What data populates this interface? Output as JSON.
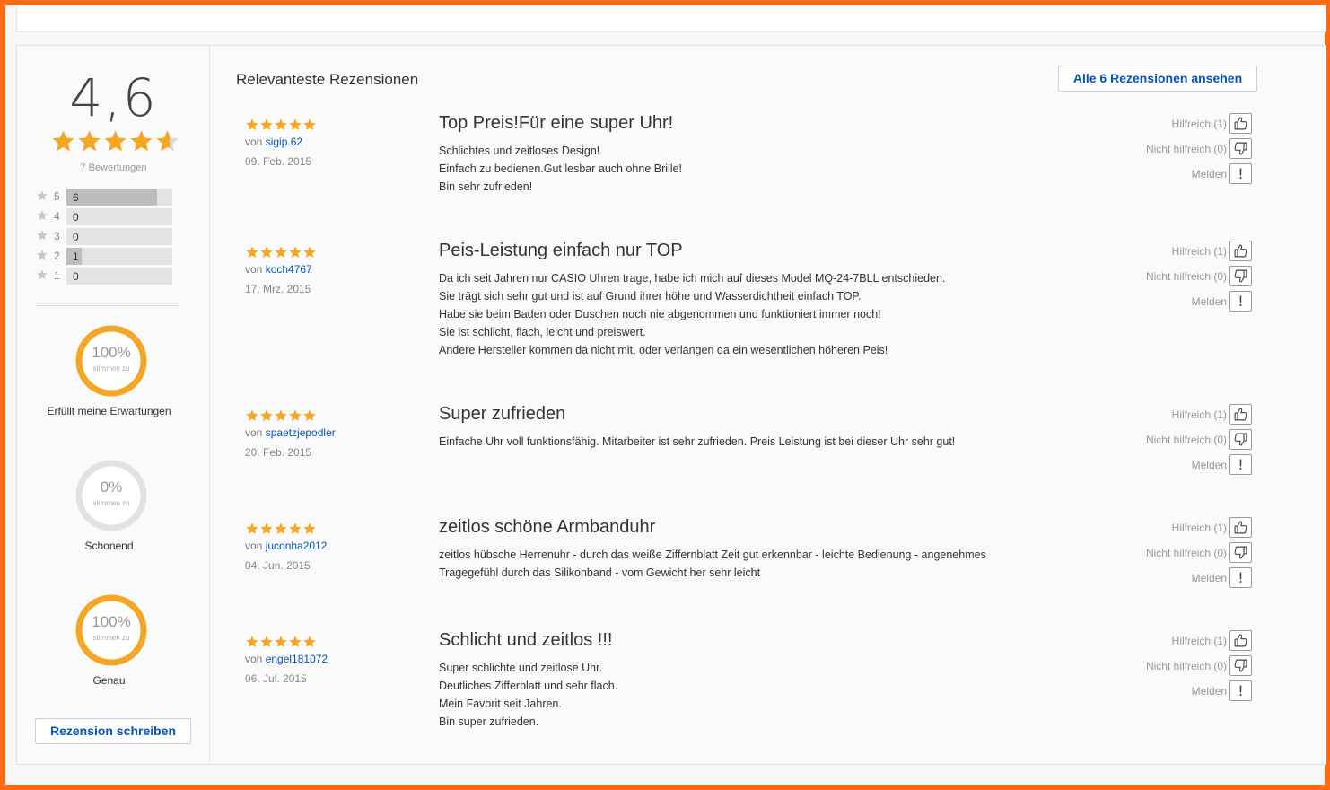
{
  "summary": {
    "average": "4,6",
    "average_stars": 4.6,
    "rating_count_label": "7 Bewertungen",
    "distribution": [
      {
        "stars": "5",
        "count": "6",
        "fraction": 0.86
      },
      {
        "stars": "4",
        "count": "0",
        "fraction": 0
      },
      {
        "stars": "3",
        "count": "0",
        "fraction": 0
      },
      {
        "stars": "2",
        "count": "1",
        "fraction": 0.14
      },
      {
        "stars": "1",
        "count": "0",
        "fraction": 0
      }
    ],
    "aspects": [
      {
        "percent_label": "100%",
        "percent": 100,
        "sub": "stimmen zu",
        "label": "Erfüllt meine Erwartungen"
      },
      {
        "percent_label": "0%",
        "percent": 0,
        "sub": "stimmen zu",
        "label": "Schonend"
      },
      {
        "percent_label": "100%",
        "percent": 100,
        "sub": "stimmen zu",
        "label": "Genau"
      }
    ],
    "write_review_label": "Rezension schreiben"
  },
  "main": {
    "title": "Relevanteste Rezensionen",
    "all_reviews_label": "Alle 6 Rezensionen ansehen"
  },
  "feedback": {
    "helpful": "Hilfreich (1)",
    "not_helpful": "Nicht hilfreich (0)",
    "report": "Melden"
  },
  "reviews": [
    {
      "rating": 5,
      "von": "von",
      "author": "sigip.62",
      "date": "09. Feb. 2015",
      "title": "Top Preis!Für eine super Uhr!",
      "lines": [
        "Schlichtes und zeitloses Design!",
        "Einfach zu bedienen.Gut lesbar auch ohne Brille!",
        "Bin sehr zufrieden!"
      ]
    },
    {
      "rating": 5,
      "von": "von",
      "author": "koch4767",
      "date": "17. Mrz. 2015",
      "title": "Peis-Leistung einfach nur TOP",
      "lines": [
        "Da ich seit Jahren nur CASIO Uhren trage, habe ich mich auf dieses Model MQ-24-7BLL entschieden.",
        "Sie trägt sich sehr gut und ist auf Grund ihrer höhe und Wasserdichtheit einfach TOP.",
        "Habe sie beim Baden oder Duschen noch nie abgenommen  und funktioniert immer noch!",
        "Sie ist schlicht, flach, leicht und preiswert.",
        "Andere Hersteller kommen da nicht mit, oder verlangen da ein wesentlichen höheren Peis!"
      ]
    },
    {
      "rating": 5,
      "von": "von",
      "author": "spaetzjepodler",
      "date": "20. Feb. 2015",
      "title": "Super zufrieden",
      "lines": [
        "Einfache Uhr voll funktionsfähig. Mitarbeiter ist sehr zufrieden. Preis Leistung ist bei dieser Uhr sehr gut!"
      ]
    },
    {
      "rating": 5,
      "von": "von",
      "author": "juconha2012",
      "date": "04. Jun. 2015",
      "title": "zeitlos schöne Armbanduhr",
      "lines": [
        "zeitlos hübsche Herrenuhr - durch das weiße Ziffernblatt Zeit gut erkennbar - leichte Bedienung - angenehmes",
        "Tragegefühl durch das Silikonband - vom Gewicht her sehr leicht"
      ]
    },
    {
      "rating": 5,
      "von": "von",
      "author": "engel181072",
      "date": "06. Jul. 2015",
      "title": "Schlicht und zeitlos !!!",
      "lines": [
        "Super schlichte und zeitlose Uhr.",
        "Deutliches Zifferblatt und sehr flach.",
        "Mein Favorit seit Jahren.",
        "Bin super zufrieden."
      ]
    }
  ],
  "colors": {
    "star": "#f5a623",
    "link": "#0654ba",
    "gauge": "#f5a623",
    "gauge_empty": "#e2e2e2",
    "frame": "#ff6a13"
  },
  "icons": {
    "star": "star-icon",
    "helpful": "thumbs-up-icon",
    "not_helpful": "thumbs-down-icon",
    "report": "exclamation-icon"
  }
}
